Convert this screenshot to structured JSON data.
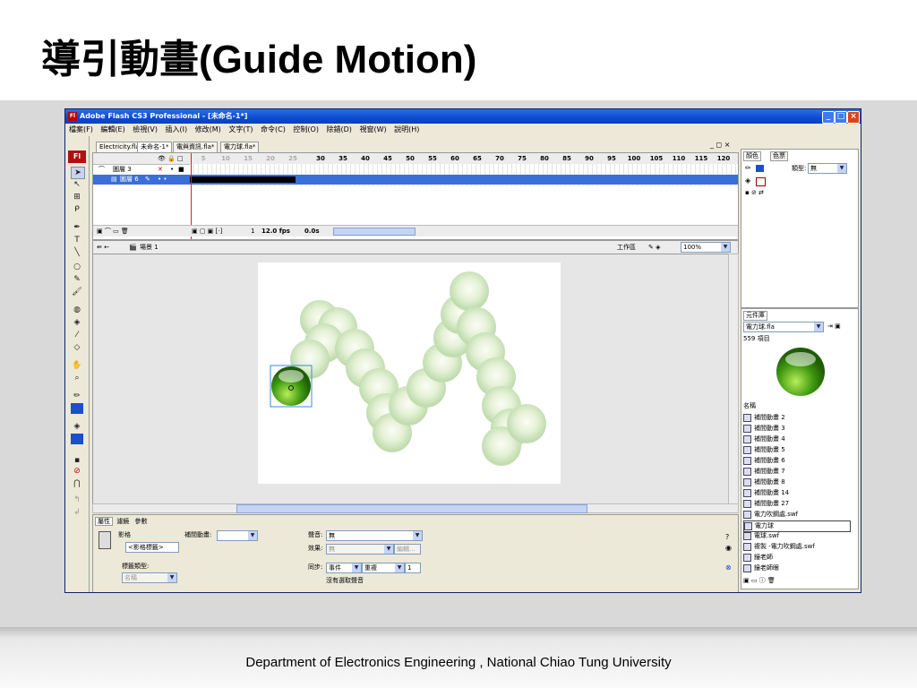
{
  "slide": {
    "title": "導引動畫(Guide Motion)",
    "footer": "Department of Electronics Engineering , National Chiao Tung University"
  },
  "window": {
    "title": "Adobe Flash CS3 Professional - [未命名-1*]",
    "app_icon": "Fl",
    "controls": {
      "minimize": "_",
      "maximize": "□",
      "close": "×"
    }
  },
  "menu": [
    "檔案(F)",
    "編輯(E)",
    "檢視(V)",
    "插入(I)",
    "修改(M)",
    "文字(T)",
    "命令(C)",
    "控制(O)",
    "除錯(D)",
    "視窗(W)",
    "說明(H)"
  ],
  "toolbox": {
    "logo": "Fl"
  },
  "doc_tabs": [
    "Electricity.fla",
    "未命名-1*",
    "電與資訊.fla*",
    "電力球.fla*"
  ],
  "timeline": {
    "frame_numbers": [
      "5",
      "10",
      "15",
      "20",
      "25",
      "30",
      "35",
      "40",
      "45",
      "50",
      "55",
      "60",
      "65",
      "70",
      "75",
      "80",
      "85",
      "90",
      "95",
      "100",
      "105",
      "110",
      "115",
      "120"
    ],
    "layers": [
      {
        "name": "圖層 3",
        "type": "guide"
      },
      {
        "name": "圖層 6",
        "type": "normal",
        "selected": true
      }
    ],
    "current_frame": "1",
    "fps": "12.0 fps",
    "time": "0.0s"
  },
  "scene": {
    "name": "場景 1",
    "workspace_label": "工作區",
    "zoom": "100%"
  },
  "properties": {
    "tabs": [
      "屬性",
      "濾鏡",
      "參數"
    ],
    "symbol_type": "影格",
    "frame_label_placeholder": "<影格標籤>",
    "tween_label": "補間動畫:",
    "tween_value": "",
    "label_type_label": "標籤類型:",
    "label_type_value": "名稱",
    "sound_label": "聲音:",
    "sound_value": "無",
    "effect_label": "效果:",
    "effect_value": "無",
    "edit_button": "編輯...",
    "sync_label": "同步:",
    "sync_value": "事件",
    "repeat_value": "重複",
    "repeat_count": "1",
    "no_sound": "沒有選取聲音"
  },
  "color_panel": {
    "tabs": [
      "顏色",
      "色票"
    ],
    "type_label": "類型:",
    "type_value": "無"
  },
  "library": {
    "tab": "元件庫",
    "file": "電力球.fla",
    "count": "559 項目",
    "column_name": "名稱",
    "items": [
      "補間動畫 2",
      "補間動畫 3",
      "補間動畫 4",
      "補間動畫 5",
      "補間動畫 6",
      "補間動畫 7",
      "補間動畫 8",
      "補間動畫 14",
      "補間動畫 27",
      "電力吹鋼處.swf",
      "電力球",
      "電球.swf",
      "複製 -電力吹鋼處.swf",
      "鐘老師",
      "鐘老師眼"
    ],
    "selected_index": 10
  },
  "colors": {
    "titlebar": "#0a4bd0",
    "ball_green": "#3a9a10",
    "playhead": "#e0202a"
  }
}
